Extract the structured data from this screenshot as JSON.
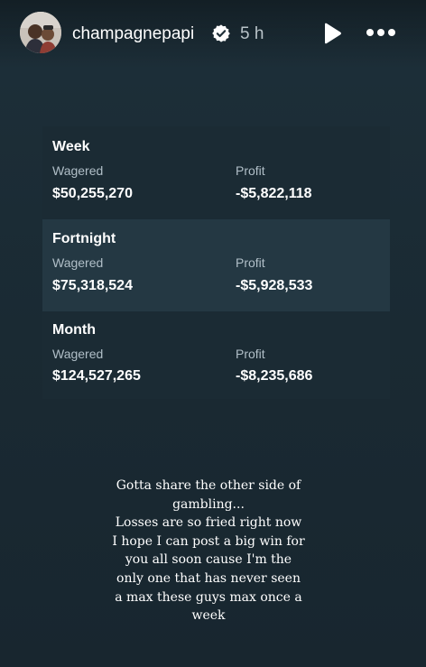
{
  "header": {
    "username": "champagnepapi",
    "timestamp": "5 h"
  },
  "stats": [
    {
      "period": "Week",
      "wagered_label": "Wagered",
      "wagered": "$50,255,270",
      "profit_label": "Profit",
      "profit": "-$5,822,118"
    },
    {
      "period": "Fortnight",
      "wagered_label": "Wagered",
      "wagered": "$75,318,524",
      "profit_label": "Profit",
      "profit": "-$5,928,533"
    },
    {
      "period": "Month",
      "wagered_label": "Wagered",
      "wagered": "$124,527,265",
      "profit_label": "Profit",
      "profit": "-$8,235,686"
    }
  ],
  "caption": {
    "lines": [
      "Gotta share the other side of",
      "gambling...",
      "Losses are so fried right now",
      "I hope I can post a big win for",
      "you all soon cause I'm the",
      "only one that has never seen",
      "a max these guys max once a",
      "week"
    ]
  },
  "colors": {
    "background": "#1a2b34",
    "highlight_row": "#243843",
    "label": "#b1bfc8"
  }
}
